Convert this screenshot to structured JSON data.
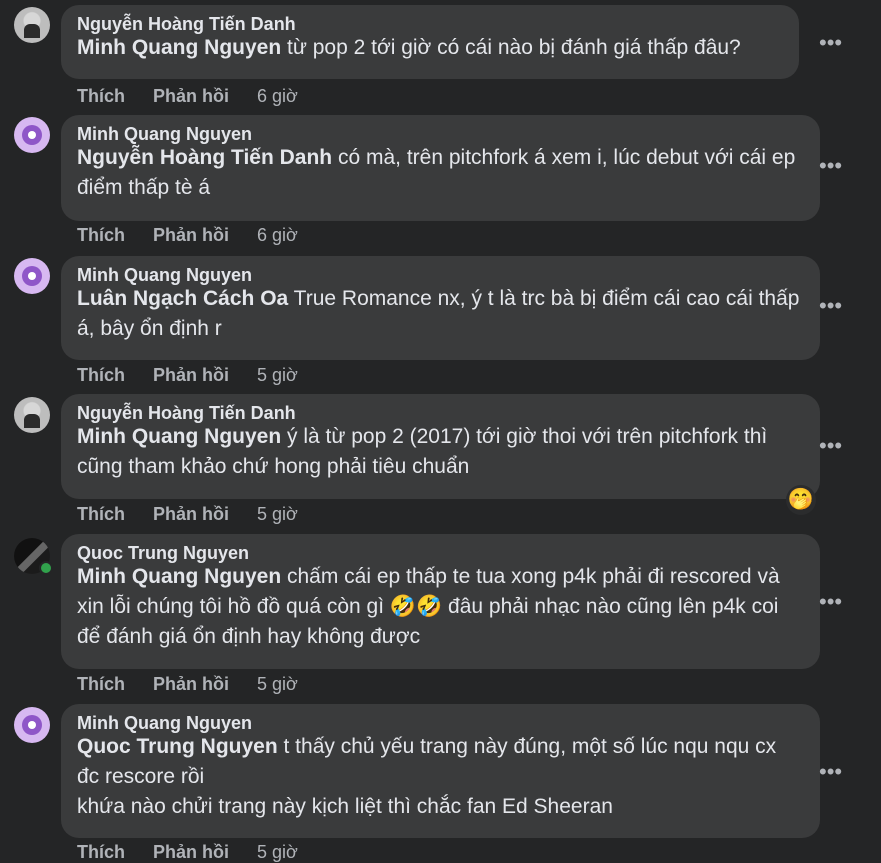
{
  "comments": [
    {
      "name": "Nguyễn Hoàng Tiến Danh",
      "mention": "Minh Quang Nguyen",
      "text": " từ pop 2 tới giờ có cái nào bị đánh giá thấp đâu?",
      "like": "Thích",
      "reply": "Phản hồi",
      "time": "6 giờ"
    },
    {
      "name": "Minh Quang Nguyen",
      "mention": "Nguyễn Hoàng Tiến Danh",
      "text": " có mà, trên pitchfork á xem i, lúc debut với cái ep điểm thấp tè á",
      "like": "Thích",
      "reply": "Phản hồi",
      "time": "6 giờ"
    },
    {
      "name": "Minh Quang Nguyen",
      "mention": "Luân Ngạch Cách Oa",
      "text": " True Romance nx, ý t là trc bà bị điểm cái cao cái thấp á, bây ổn định r",
      "like": "Thích",
      "reply": "Phản hồi",
      "time": "5 giờ"
    },
    {
      "name": "Nguyễn Hoàng Tiến Danh",
      "mention": "Minh Quang Nguyen",
      "text": " ý là từ pop 2 (2017) tới giờ thoi với trên pitchfork thì cũng tham khảo chứ hong phải tiêu chuẩn",
      "like": "Thích",
      "reply": "Phản hồi",
      "time": "5 giờ",
      "reaction": "🤭"
    },
    {
      "name": "Quoc Trung Nguyen",
      "mention": "Minh Quang Nguyen",
      "text": " chấm cái ep thấp te tua xong p4k phải đi rescored và xin lỗi chúng tôi hồ đồ quá còn gì 🤣🤣 đâu phải nhạc nào cũng lên p4k coi để đánh giá ổn định hay không được",
      "like": "Thích",
      "reply": "Phản hồi",
      "time": "5 giờ"
    },
    {
      "name": "Minh Quang Nguyen",
      "mention": "Quoc Trung Nguyen",
      "text": " t thấy chủ yếu trang này đúng, một số lúc nqu nqu cx đc rescore rồi",
      "text2": "khứa nào chửi trang này kịch liệt thì chắc fan Ed Sheeran",
      "like": "Thích",
      "reply": "Phản hồi",
      "time": "5 giờ"
    }
  ],
  "more_icon": "more-horizontal-icon"
}
